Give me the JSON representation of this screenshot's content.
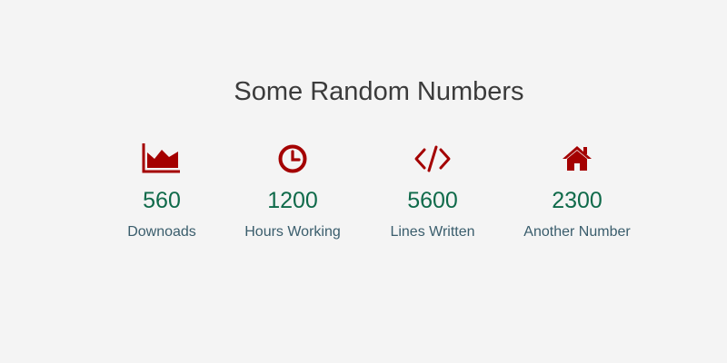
{
  "section": {
    "title": "Some Random Numbers"
  },
  "stats": [
    {
      "icon": "area-chart-icon",
      "value": "560",
      "label": "Downoads"
    },
    {
      "icon": "clock-icon",
      "value": "1200",
      "label": "Hours Working"
    },
    {
      "icon": "code-icon",
      "value": "5600",
      "label": "Lines Written"
    },
    {
      "icon": "home-icon",
      "value": "2300",
      "label": "Another Number"
    }
  ],
  "colors": {
    "background": "#f4f4f4",
    "icon": "#a40000",
    "value": "#0f6a4a",
    "label": "#3a5d6c",
    "title": "#3b3b3b"
  }
}
